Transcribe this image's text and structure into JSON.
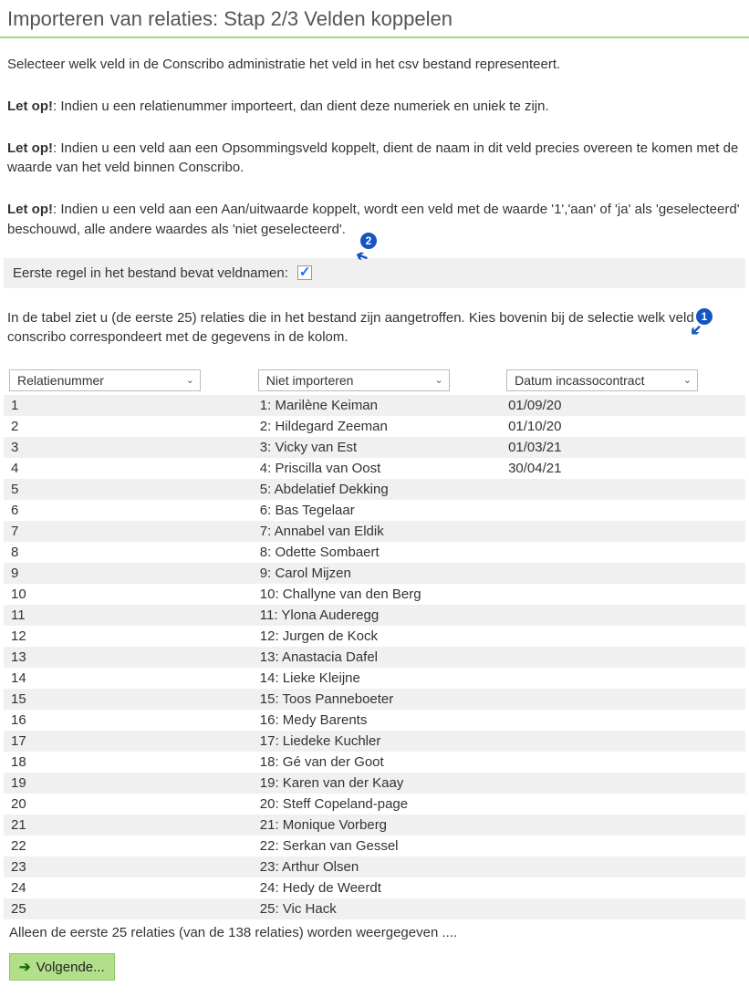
{
  "title": "Importeren van relaties: Stap 2/3 Velden koppelen",
  "intro": "Selecteer welk veld in de Conscribo administratie het veld in het csv bestand representeert.",
  "warnings": [
    {
      "bold": "Let op!",
      "text": ": Indien u een relatienummer importeert, dan dient deze numeriek en uniek te zijn."
    },
    {
      "bold": "Let op!",
      "text": ": Indien u een veld aan een Opsommingsveld koppelt, dient de naam in dit veld precies overeen te komen met de waarde van het veld binnen Conscribo."
    },
    {
      "bold": "Let op!",
      "text": ": Indien u een veld aan een Aan/uitwaarde koppelt, wordt een veld met de waarde '1','aan' of 'ja' als 'geselecteerd' beschouwd, alle andere waardes als 'niet geselecteerd'."
    }
  ],
  "checkbox": {
    "label": "Eerste regel in het bestand bevat veldnamen:",
    "checked": true
  },
  "tableIntro": "In de tabel ziet u (de eerste 25) relaties die in het bestand zijn aangetroffen. Kies bovenin bij de selectie welk veld in conscribo correspondeert met de gegevens in de kolom.",
  "columns": {
    "select1": "Relatienummer",
    "select2": "Niet importeren",
    "select3": "Datum incassocontract"
  },
  "rows": [
    {
      "c1": "1",
      "c2": "1: Marilène Keiman",
      "c3": "01/09/20"
    },
    {
      "c1": "2",
      "c2": "2: Hildegard Zeeman",
      "c3": "01/10/20"
    },
    {
      "c1": "3",
      "c2": "3: Vicky van Est",
      "c3": "01/03/21"
    },
    {
      "c1": "4",
      "c2": "4: Priscilla van Oost",
      "c3": "30/04/21"
    },
    {
      "c1": "5",
      "c2": "5: Abdelatief Dekking",
      "c3": ""
    },
    {
      "c1": "6",
      "c2": "6: Bas Tegelaar",
      "c3": ""
    },
    {
      "c1": "7",
      "c2": "7: Annabel van Eldik",
      "c3": ""
    },
    {
      "c1": "8",
      "c2": "8: Odette Sombaert",
      "c3": ""
    },
    {
      "c1": "9",
      "c2": "9: Carol Mijzen",
      "c3": ""
    },
    {
      "c1": "10",
      "c2": "10: Challyne van den Berg",
      "c3": ""
    },
    {
      "c1": "11",
      "c2": "11: Ylona Auderegg",
      "c3": ""
    },
    {
      "c1": "12",
      "c2": "12: Jurgen de Kock",
      "c3": ""
    },
    {
      "c1": "13",
      "c2": "13: Anastacia Dafel",
      "c3": ""
    },
    {
      "c1": "14",
      "c2": "14: Lieke Kleijne",
      "c3": ""
    },
    {
      "c1": "15",
      "c2": "15: Toos Panneboeter",
      "c3": ""
    },
    {
      "c1": "16",
      "c2": "16: Medy Barents",
      "c3": ""
    },
    {
      "c1": "17",
      "c2": "17: Liedeke Kuchler",
      "c3": ""
    },
    {
      "c1": "18",
      "c2": "18: Gé van der Goot",
      "c3": ""
    },
    {
      "c1": "19",
      "c2": "19: Karen van der Kaay",
      "c3": ""
    },
    {
      "c1": "20",
      "c2": "20: Steff Copeland-page",
      "c3": ""
    },
    {
      "c1": "21",
      "c2": "21: Monique Vorberg",
      "c3": ""
    },
    {
      "c1": "22",
      "c2": "22: Serkan van Gessel",
      "c3": ""
    },
    {
      "c1": "23",
      "c2": "23: Arthur Olsen",
      "c3": ""
    },
    {
      "c1": "24",
      "c2": "24: Hedy de Weerdt",
      "c3": ""
    },
    {
      "c1": "25",
      "c2": "25: Vic Hack",
      "c3": ""
    }
  ],
  "footerNote": "Alleen de eerste 25 relaties (van de 138 relaties) worden weergegeven ....",
  "nextLabel": "Volgende...",
  "annotations": {
    "a1": "1",
    "a2": "2"
  }
}
